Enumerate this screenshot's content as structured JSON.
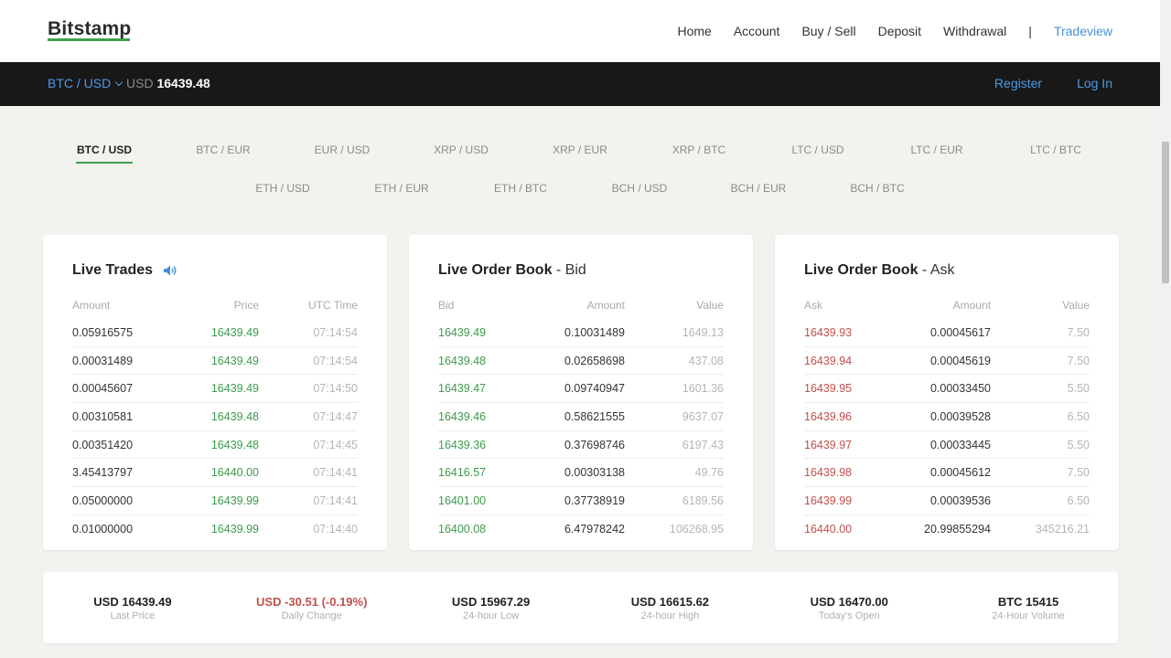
{
  "header": {
    "logo": "Bitstamp",
    "nav": [
      "Home",
      "Account",
      "Buy / Sell",
      "Deposit",
      "Withdrawal"
    ],
    "separator": "|",
    "active_nav": "Tradeview"
  },
  "ticker": {
    "pair": "BTC / USD",
    "currency": "USD",
    "price": "16439.48",
    "register": "Register",
    "login": "Log In"
  },
  "pairs": {
    "row1": [
      "BTC / USD",
      "BTC / EUR",
      "EUR / USD",
      "XRP / USD",
      "XRP / EUR",
      "XRP / BTC",
      "LTC / USD",
      "LTC / EUR",
      "LTC / BTC"
    ],
    "row2": [
      "ETH / USD",
      "ETH / EUR",
      "ETH / BTC",
      "BCH / USD",
      "BCH / EUR",
      "BCH / BTC"
    ]
  },
  "trades": {
    "title": "Live Trades",
    "headers": [
      "Amount",
      "Price",
      "UTC Time"
    ],
    "rows": [
      [
        "0.05916575",
        "16439.49",
        "07:14:54"
      ],
      [
        "0.00031489",
        "16439.49",
        "07:14:54"
      ],
      [
        "0.00045607",
        "16439.49",
        "07:14:50"
      ],
      [
        "0.00310581",
        "16439.48",
        "07:14:47"
      ],
      [
        "0.00351420",
        "16439.48",
        "07:14:45"
      ],
      [
        "3.45413797",
        "16440.00",
        "07:14:41"
      ],
      [
        "0.05000000",
        "16439.99",
        "07:14:41"
      ],
      [
        "0.01000000",
        "16439.99",
        "07:14:40"
      ]
    ]
  },
  "bid": {
    "title": "Live Order Book",
    "subtitle": " - Bid",
    "headers": [
      "Bid",
      "Amount",
      "Value"
    ],
    "rows": [
      [
        "16439.49",
        "0.10031489",
        "1649.13"
      ],
      [
        "16439.48",
        "0.02658698",
        "437.08"
      ],
      [
        "16439.47",
        "0.09740947",
        "1601.36"
      ],
      [
        "16439.46",
        "0.58621555",
        "9637.07"
      ],
      [
        "16439.36",
        "0.37698746",
        "6197.43"
      ],
      [
        "16416.57",
        "0.00303138",
        "49.76"
      ],
      [
        "16401.00",
        "0.37738919",
        "6189.56"
      ],
      [
        "16400.08",
        "6.47978242",
        "106268.95"
      ]
    ]
  },
  "ask": {
    "title": "Live Order Book",
    "subtitle": " - Ask",
    "headers": [
      "Ask",
      "Amount",
      "Value"
    ],
    "rows": [
      [
        "16439.93",
        "0.00045617",
        "7.50"
      ],
      [
        "16439.94",
        "0.00045619",
        "7.50"
      ],
      [
        "16439.95",
        "0.00033450",
        "5.50"
      ],
      [
        "16439.96",
        "0.00039528",
        "6.50"
      ],
      [
        "16439.97",
        "0.00033445",
        "5.50"
      ],
      [
        "16439.98",
        "0.00045612",
        "7.50"
      ],
      [
        "16439.99",
        "0.00039536",
        "6.50"
      ],
      [
        "16440.00",
        "20.99855294",
        "345216.21"
      ]
    ]
  },
  "stats": [
    {
      "value": "USD 16439.49",
      "label": "Last Price"
    },
    {
      "value": "USD -30.51 (-0.19%)",
      "label": "Daily Change"
    },
    {
      "value": "USD 15967.29",
      "label": "24-hour Low"
    },
    {
      "value": "USD 16615.62",
      "label": "24-hour High"
    },
    {
      "value": "USD 16470.00",
      "label": "Today's Open"
    },
    {
      "value": "BTC 15415",
      "label": "24-Hour Volume"
    }
  ],
  "colors": {
    "accent_green": "#3fa14d",
    "link_blue": "#4a9be3",
    "buy_green": "#3d9b4a",
    "sell_red": "#c0504d",
    "dark_bar": "#181818"
  }
}
